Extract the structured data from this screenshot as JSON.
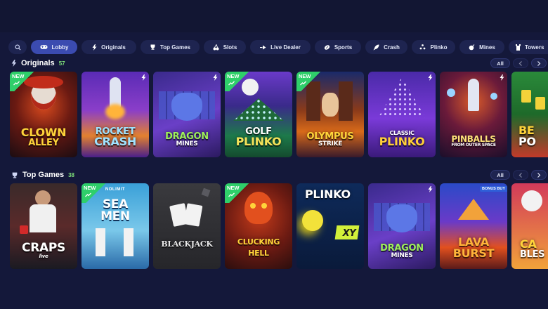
{
  "nav": {
    "search_icon": "search-icon",
    "tabs": [
      {
        "label": "Lobby",
        "icon": "gamepad-icon",
        "active": true
      },
      {
        "label": "Originals",
        "icon": "bolt-icon"
      },
      {
        "label": "Top Games",
        "icon": "trophy-icon"
      },
      {
        "label": "Slots",
        "icon": "cherries-icon"
      },
      {
        "label": "Live Dealer",
        "icon": "chip-icon"
      },
      {
        "label": "Sports",
        "icon": "ball-icon"
      },
      {
        "label": "Crash",
        "icon": "rocket-icon"
      },
      {
        "label": "Plinko",
        "icon": "dots-icon"
      },
      {
        "label": "Mines",
        "icon": "bomb-icon"
      },
      {
        "label": "Towers",
        "icon": "tower-icon"
      }
    ]
  },
  "originals": {
    "title": "Originals",
    "count": "57",
    "all_label": "All",
    "games": [
      {
        "line1": "CLOWN",
        "line2": "ALLEY",
        "badge": "NEW"
      },
      {
        "line1": "ROCKET",
        "line2": "CRASH"
      },
      {
        "line1": "DRAGON",
        "line2": "MINES"
      },
      {
        "line1": "GOLF",
        "line2": "PLINKO",
        "badge": "NEW"
      },
      {
        "line1": "OLYMPUS",
        "line2": "STRIKE",
        "badge": "NEW"
      },
      {
        "line1": "CLASSIC",
        "line2": "PLINKO"
      },
      {
        "line1": "PINBALLS",
        "line2": "FROM OUTER SPACE"
      },
      {
        "line1": "BE",
        "line2": "PO"
      }
    ]
  },
  "top_games": {
    "title": "Top Games",
    "count": "38",
    "all_label": "All",
    "games": [
      {
        "line1": "CRAPS",
        "line2": "live"
      },
      {
        "line1": "SEA",
        "line2": "MEN",
        "badge": "NEW",
        "provider": "NOLIMIT"
      },
      {
        "line1": "BLACKJACK",
        "line2": ""
      },
      {
        "line1": "CLUCKING",
        "line2": "HELL",
        "badge": "NEW"
      },
      {
        "line1": "PLINKO",
        "line2": "XY"
      },
      {
        "line1": "DRAGON",
        "line2": "MINES"
      },
      {
        "line1": "LAVA",
        "line2": "BURST",
        "bonus": "BONUS BUY"
      },
      {
        "line1": "CA",
        "line2": "BLES"
      }
    ]
  },
  "colors": {
    "bg": "#14183a",
    "chip": "#1e2450",
    "active": "#3b4bb0",
    "count": "#7fe07a",
    "new": "#2fcf6a"
  }
}
